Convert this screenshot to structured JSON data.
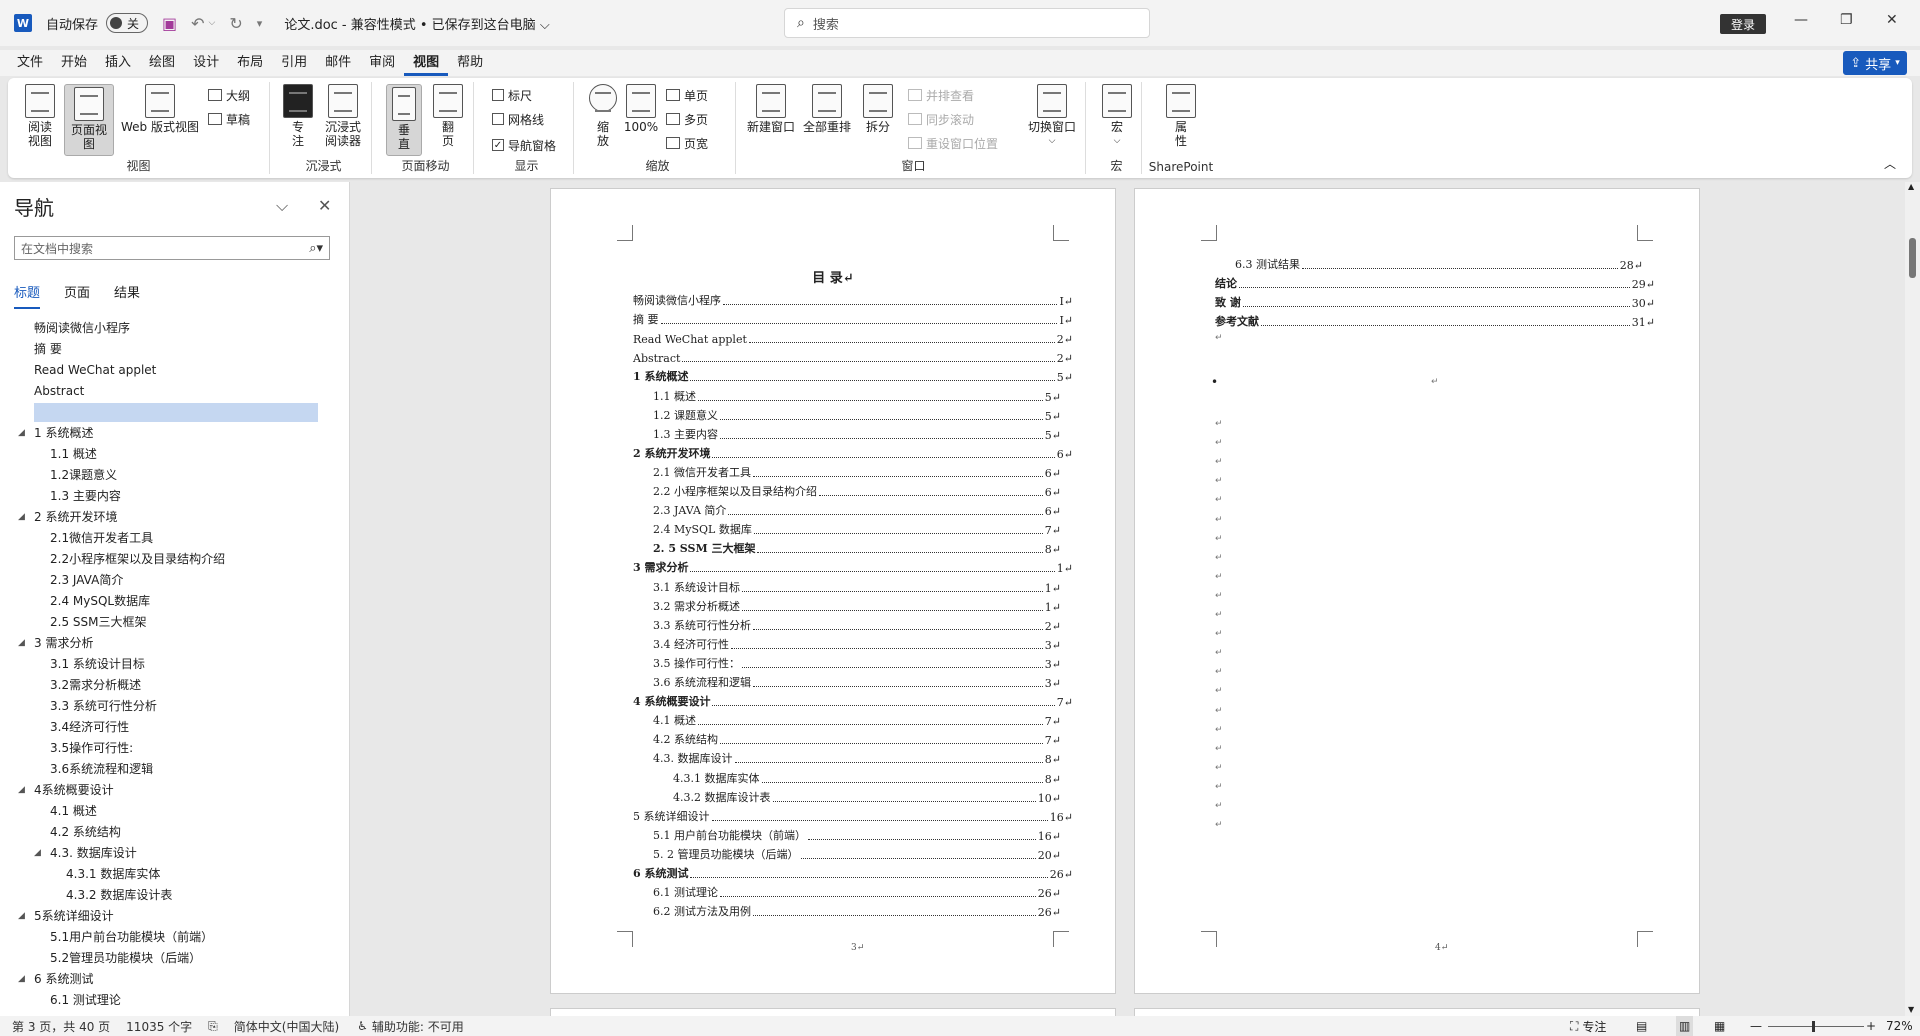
{
  "titlebar": {
    "app_icon": "W",
    "autosave_label": "自动保存",
    "autosave_state": "关",
    "doc_title": "论文.doc  -  兼容性模式 • 已保存到这台电脑 ⌵",
    "search_placeholder": "搜索",
    "login_label": "登录",
    "icons": [
      "save-icon",
      "undo-icon",
      "redo-icon",
      "customize-qat-icon",
      "minimize-icon",
      "maximize-icon",
      "close-icon"
    ]
  },
  "menu": {
    "items": [
      "文件",
      "开始",
      "插入",
      "绘图",
      "设计",
      "布局",
      "引用",
      "邮件",
      "审阅",
      "视图",
      "帮助"
    ],
    "active": "视图",
    "share_label": "共享"
  },
  "ribbon": {
    "groups": {
      "views": "视图",
      "immersive": "沉浸式",
      "page_movement": "页面移动",
      "show": "显示",
      "zoom": "缩放",
      "window": "窗口",
      "macros": "宏",
      "sharepoint": "SharePoint"
    },
    "buttons": {
      "read_mode": "阅读\n视图",
      "print_layout": "页面视图",
      "web_layout": "Web 版式视图",
      "outline": "大纲",
      "draft": "草稿",
      "focus": "专\n注",
      "immersive_reader": "沉浸式\n阅读器",
      "vertical": "垂\n直",
      "side_to_side": "翻\n页",
      "ruler": "标尺",
      "gridlines": "网格线",
      "nav_pane": "导航窗格",
      "zoom": "缩\n放",
      "zoom_100": "100%",
      "one_page": "单页",
      "multiple_pages": "多页",
      "page_width": "页宽",
      "new_window": "新建窗口",
      "arrange_all": "全部重排",
      "split": "拆分",
      "view_side_by_side": "并排查看",
      "sync_scroll": "同步滚动",
      "reset_window": "重设窗口位置",
      "switch_windows": "切换窗口",
      "macros": "宏",
      "properties": "属\n性"
    },
    "checkboxes": {
      "ruler": false,
      "gridlines": false,
      "nav_pane": true
    }
  },
  "nav": {
    "title": "导航",
    "search_placeholder": "在文档中搜索",
    "tabs": [
      "标题",
      "页面",
      "结果"
    ],
    "active_tab": "标题",
    "items": [
      {
        "label": "畅阅读微信小程序",
        "level": 1,
        "caret": false
      },
      {
        "label": "摘 要",
        "level": 1,
        "caret": false
      },
      {
        "label": "Read WeChat applet",
        "level": 1,
        "caret": false
      },
      {
        "label": "Abstract",
        "level": 1,
        "caret": false
      },
      {
        "label": "",
        "level": 1,
        "caret": false,
        "selected": true
      },
      {
        "label": "1 系统概述",
        "level": 1,
        "caret": true
      },
      {
        "label": "1.1 概述",
        "level": 2,
        "caret": false
      },
      {
        "label": "1.2课题意义",
        "level": 2,
        "caret": false
      },
      {
        "label": "1.3 主要内容",
        "level": 2,
        "caret": false
      },
      {
        "label": "2 系统开发环境",
        "level": 1,
        "caret": true
      },
      {
        "label": "2.1微信开发者工具",
        "level": 2,
        "caret": false
      },
      {
        "label": "2.2小程序框架以及目录结构介绍",
        "level": 2,
        "caret": false
      },
      {
        "label": "2.3 JAVA简介",
        "level": 2,
        "caret": false
      },
      {
        "label": "2.4 MySQL数据库",
        "level": 2,
        "caret": false
      },
      {
        "label": "2.5 SSM三大框架",
        "level": 2,
        "caret": false
      },
      {
        "label": "3 需求分析",
        "level": 1,
        "caret": true
      },
      {
        "label": "3.1 系统设计目标",
        "level": 2,
        "caret": false
      },
      {
        "label": "3.2需求分析概述",
        "level": 2,
        "caret": false
      },
      {
        "label": "3.3 系统可行性分析",
        "level": 2,
        "caret": false
      },
      {
        "label": "3.4经济可行性",
        "level": 2,
        "caret": false
      },
      {
        "label": "3.5操作可行性:",
        "level": 2,
        "caret": false
      },
      {
        "label": "3.6系统流程和逻辑",
        "level": 2,
        "caret": false
      },
      {
        "label": "4系统概要设计",
        "level": 1,
        "caret": true
      },
      {
        "label": "4.1 概述",
        "level": 2,
        "caret": false
      },
      {
        "label": "4.2 系统结构",
        "level": 2,
        "caret": false
      },
      {
        "label": "4.3. 数据库设计",
        "level": 2,
        "caret": true
      },
      {
        "label": "4.3.1 数据库实体",
        "level": 3,
        "caret": false
      },
      {
        "label": "4.3.2 数据库设计表",
        "level": 3,
        "caret": false
      },
      {
        "label": "5系统详细设计",
        "level": 1,
        "caret": true
      },
      {
        "label": "5.1用户前台功能模块（前端）",
        "level": 2,
        "caret": false
      },
      {
        "label": "5.2管理员功能模块（后端）",
        "level": 2,
        "caret": false
      },
      {
        "label": "6 系统测试",
        "level": 1,
        "caret": true
      },
      {
        "label": "6.1 测试理论",
        "level": 2,
        "caret": false
      }
    ]
  },
  "page_left": {
    "heading": "目  录↵",
    "entries": [
      {
        "t": "畅阅读微信小程序",
        "p": "I↵",
        "indent": 0,
        "bold": false
      },
      {
        "t": "摘 要",
        "p": "I↵",
        "indent": 0,
        "bold": false
      },
      {
        "t": "Read WeChat applet",
        "p": "2↵",
        "indent": 0,
        "bold": false
      },
      {
        "t": "Abstract",
        "p": "2↵",
        "indent": 0,
        "bold": false
      },
      {
        "t": "1  系统概述",
        "p": "5↵",
        "indent": 0,
        "bold": true
      },
      {
        "t": "1.1  概述",
        "p": "5↵",
        "indent": 1,
        "bold": false
      },
      {
        "t": "1.2 课题意义",
        "p": "5↵",
        "indent": 1,
        "bold": false
      },
      {
        "t": "1.3  主要内容",
        "p": "5↵",
        "indent": 1,
        "bold": false
      },
      {
        "t": "2  系统开发环境",
        "p": "6↵",
        "indent": 0,
        "bold": true
      },
      {
        "t": "2.1 微信开发者工具",
        "p": "6↵",
        "indent": 1,
        "bold": false
      },
      {
        "t": "2.2 小程序框架以及目录结构介绍",
        "p": "6↵",
        "indent": 1,
        "bold": false
      },
      {
        "t": "2.3  JAVA 简介",
        "p": "6↵",
        "indent": 1,
        "bold": false
      },
      {
        "t": "2.4  MySQL 数据库",
        "p": "7↵",
        "indent": 1,
        "bold": false
      },
      {
        "t": "2. 5  SSM 三大框架",
        "p": "8↵",
        "indent": 1,
        "bold": true
      },
      {
        "t": "3  需求分析",
        "p": "1↵",
        "indent": 0,
        "bold": true
      },
      {
        "t": "3.1  系统设计目标",
        "p": "1↵",
        "indent": 1,
        "bold": false
      },
      {
        "t": "3.2 需求分析概述",
        "p": "1↵",
        "indent": 1,
        "bold": false
      },
      {
        "t": "3.3  系统可行性分析",
        "p": "2↵",
        "indent": 1,
        "bold": false
      },
      {
        "t": "3.4 经济可行性",
        "p": "3↵",
        "indent": 1,
        "bold": false
      },
      {
        "t": "3.5 操作可行性：",
        "p": "3↵",
        "indent": 1,
        "bold": false
      },
      {
        "t": "3.6 系统流程和逻辑",
        "p": "3↵",
        "indent": 1,
        "bold": false
      },
      {
        "t": "4 系统概要设计",
        "p": "7↵",
        "indent": 0,
        "bold": true
      },
      {
        "t": "4.1  概述",
        "p": "7↵",
        "indent": 1,
        "bold": false
      },
      {
        "t": "4.2  系统结构",
        "p": "7↵",
        "indent": 1,
        "bold": false
      },
      {
        "t": "4.3.  数据库设计",
        "p": "8↵",
        "indent": 1,
        "bold": false
      },
      {
        "t": "4.3.1  数据库实体",
        "p": "8↵",
        "indent": 2,
        "bold": false
      },
      {
        "t": "4.3.2  数据库设计表",
        "p": "10↵",
        "indent": 2,
        "bold": false
      },
      {
        "t": "5 系统详细设计",
        "p": "16↵",
        "indent": 0,
        "bold": false
      },
      {
        "t": "5.1 用户前台功能模块（前端）",
        "p": "16↵",
        "indent": 1,
        "bold": false
      },
      {
        "t": "5. 2 管理员功能模块（后端）",
        "p": "20↵",
        "indent": 1,
        "bold": false
      },
      {
        "t": "6  系统测试",
        "p": "26↵",
        "indent": 0,
        "bold": true
      },
      {
        "t": "6.1  测试理论",
        "p": "26↵",
        "indent": 1,
        "bold": false
      },
      {
        "t": "6.2  测试方法及用例",
        "p": "26↵",
        "indent": 1,
        "bold": false
      }
    ],
    "page_number": "3↵"
  },
  "page_right": {
    "entries": [
      {
        "t": "6.3 测试结果",
        "p": "28↵",
        "indent": 1,
        "bold": false
      },
      {
        "t": "结论",
        "p": "29↵",
        "indent": 0,
        "bold": true
      },
      {
        "t": "致  谢",
        "p": "30↵",
        "indent": 0,
        "bold": true
      },
      {
        "t": "参考文献",
        "p": "31↵",
        "indent": 0,
        "bold": true
      }
    ],
    "para_mark": "↵",
    "bullet": "•",
    "page_number": "4↵"
  },
  "status": {
    "page": "第 3 页，共 40 页",
    "words": "11035 个字",
    "language": "简体中文(中国大陆)",
    "accessibility": "辅助功能: 不可用",
    "focus": "专注",
    "zoom": "72%"
  }
}
